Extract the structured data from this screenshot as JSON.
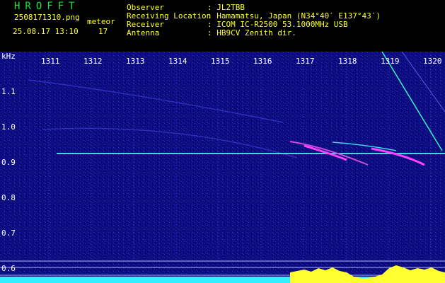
{
  "header": {
    "title": "HROFFT",
    "filename": "2508171310.png",
    "type_label": "meteor",
    "datetime": "25.08.17 13:10",
    "count": "17",
    "observer_label": "Observer",
    "observer_value": ": JL2TBB",
    "location_label": "Receiving Location",
    "location_value": ": Hamamatsu, Japan (N34°40′ E137°43′)",
    "receiver_label": "Receiver",
    "receiver_value": ": ICOM IC-R2500 53.1000MHz USB",
    "antenna_label": "Antenna",
    "antenna_value": ": HB9CV Zenith dir."
  },
  "axis": {
    "y_unit": "kHz",
    "x_ticks": [
      "1311",
      "1312",
      "1313",
      "1314",
      "1315",
      "1316",
      "1317",
      "1318",
      "1319",
      "1320"
    ],
    "y_ticks": [
      "1.1",
      "1.0",
      "0.9",
      "0.8",
      "0.7",
      "0.6"
    ]
  },
  "colors": {
    "background": "#10108a",
    "carrier": "#38d8e8",
    "meteor": "#ff40ff",
    "level": "#ffff30",
    "baseline": "#30f0ff"
  }
}
